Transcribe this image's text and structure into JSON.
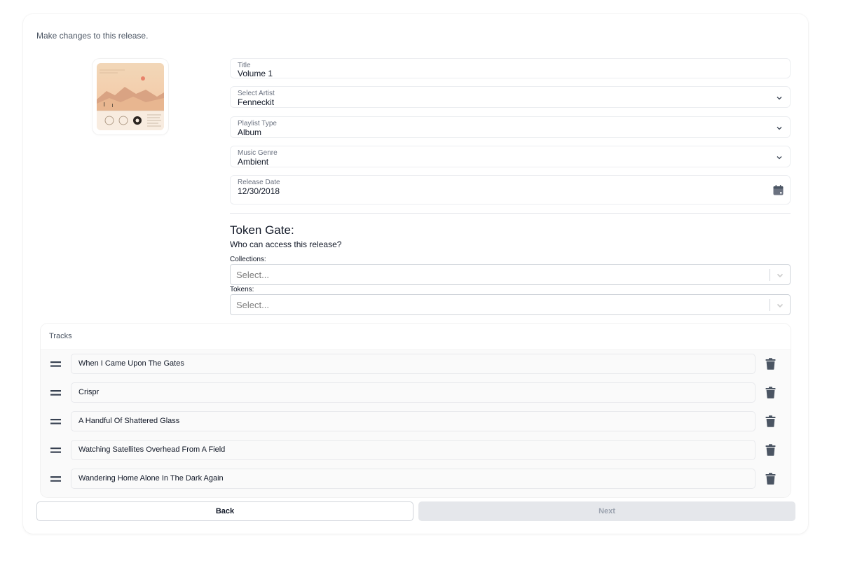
{
  "page": {
    "subtitle": "Make changes to this release."
  },
  "cover": {
    "icon": "album-cover-image"
  },
  "form": {
    "title": {
      "label": "Title",
      "value": "Volume 1"
    },
    "artist": {
      "label": "Select Artist",
      "value": "Fenneckit"
    },
    "playlist_type": {
      "label": "Playlist Type",
      "value": "Album"
    },
    "genre": {
      "label": "Music Genre",
      "value": "Ambient"
    },
    "release_date": {
      "label": "Release Date",
      "value": "12/30/2018"
    }
  },
  "token_gate": {
    "heading": "Token Gate:",
    "question": "Who can access this release?",
    "collections": {
      "label": "Collections:",
      "placeholder": "Select..."
    },
    "tokens": {
      "label": "Tokens:",
      "placeholder": "Select..."
    }
  },
  "tracks": {
    "header": "Tracks",
    "items": [
      {
        "title": "When I Came Upon The Gates"
      },
      {
        "title": "Crispr"
      },
      {
        "title": "A Handful Of Shattered Glass"
      },
      {
        "title": "Watching Satellites Overhead From A Field"
      },
      {
        "title": "Wandering Home Alone In The Dark Again"
      }
    ]
  },
  "buttons": {
    "back": "Back",
    "next": "Next"
  },
  "colors": {
    "text": "#111827",
    "muted": "#6b7280",
    "border": "#d1d5db",
    "disabled_bg": "#e5e7eb",
    "disabled_text": "#9ca3af",
    "icon": "#4b5563"
  }
}
